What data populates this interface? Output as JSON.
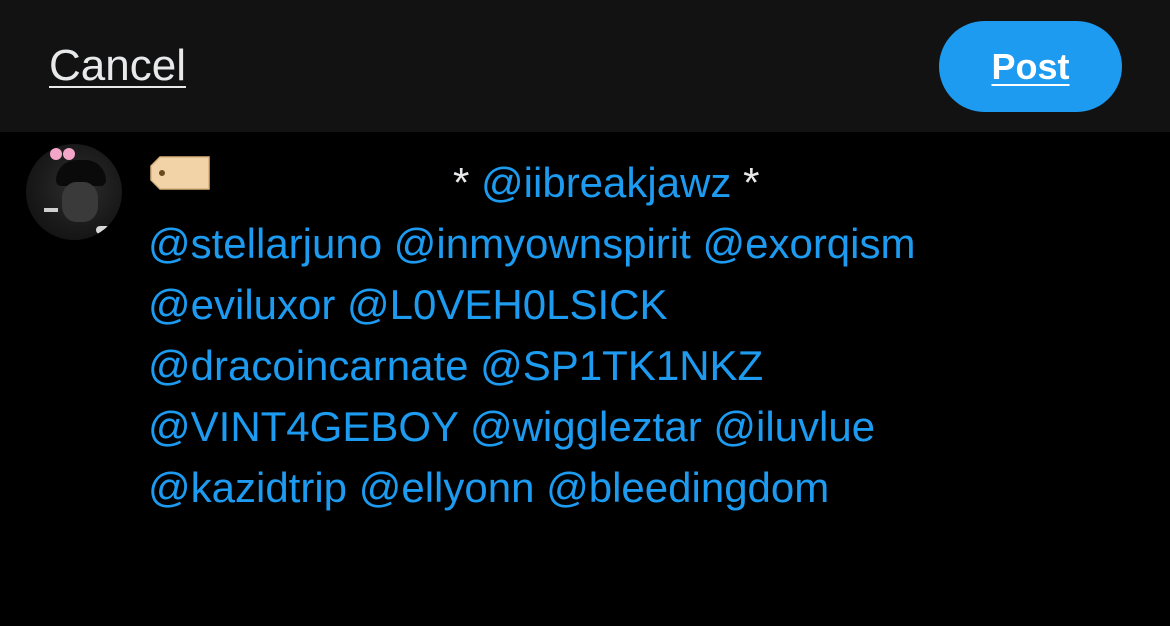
{
  "header": {
    "cancel_label": "Cancel",
    "post_label": "Post"
  },
  "colors": {
    "accent": "#1d9bf0",
    "background": "#000000",
    "topbar": "#121212",
    "text": "#e7e9ea"
  },
  "composer": {
    "avatar_icon": "profile-avatar",
    "tag_icon": "label-tag-icon",
    "star_left": "*",
    "star_right": "*",
    "first_mention": "@iibreakjawz",
    "lines": [
      [
        "@stellarjuno",
        "@inmyownspirit",
        "@exorqism"
      ],
      [
        "@eviluxor",
        "@L0VEH0LSICK"
      ],
      [
        "@dracoincarnate",
        "@SP1TK1NKZ"
      ],
      [
        "@VINT4GEBOY",
        "@wiggleztar",
        "@iluvlue"
      ],
      [
        "@kazidtrip",
        "@ellyonn",
        "@bleedingdom"
      ]
    ]
  }
}
